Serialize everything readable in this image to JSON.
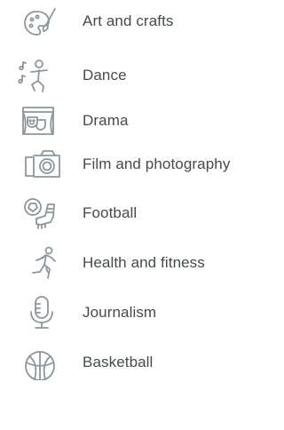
{
  "colors": {
    "icon": "#8c979b",
    "text": "#444a4d"
  },
  "activities": [
    {
      "label": "Art and crafts",
      "icon": "palette-brush-icon"
    },
    {
      "label": "Dance",
      "icon": "dancer-icon"
    },
    {
      "label": "Drama",
      "icon": "theatre-stage-icon"
    },
    {
      "label": "Film and photography",
      "icon": "camera-icon"
    },
    {
      "label": "Football",
      "icon": "football-boot-icon"
    },
    {
      "label": "Health and fitness",
      "icon": "runner-icon"
    },
    {
      "label": "Journalism",
      "icon": "microphone-icon"
    },
    {
      "label": "Basketball",
      "icon": "basketball-icon"
    }
  ]
}
